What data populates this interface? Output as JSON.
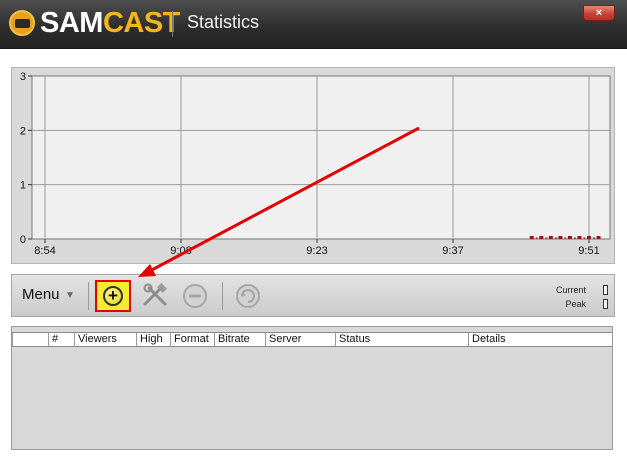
{
  "window": {
    "logo_part1": "SAM",
    "logo_part2": "CAST",
    "title": "Statistics",
    "close_glyph": "×"
  },
  "chart_data": {
    "type": "line",
    "ylim": [
      0,
      3
    ],
    "yticks": [
      "0",
      "1",
      "2",
      "3"
    ],
    "xticks": [
      "8:54",
      "9:08",
      "9:23",
      "9:37",
      "9:51"
    ],
    "grid": true,
    "series": [
      {
        "x": [
          "9:45",
          "9:46",
          "9:47",
          "9:48",
          "9:49",
          "9:50",
          "9:51",
          "9:52"
        ],
        "values": [
          0,
          0,
          0,
          0,
          0,
          0,
          0,
          0
        ],
        "color": "#8b1a1a"
      }
    ]
  },
  "toolbar": {
    "menu_label": "Menu",
    "menu_arrow": "▼",
    "add_glyph": "+",
    "current_label": "Current",
    "peak_label": "Peak"
  },
  "icons": [
    "plus-circle-icon",
    "tools-icon",
    "minus-circle-icon",
    "refresh-icon"
  ],
  "table": {
    "columns": [
      "",
      "#",
      "Viewers",
      "High",
      "Format",
      "Bitrate",
      "Server",
      "Status",
      "Details"
    ],
    "rows": []
  },
  "colors": {
    "annotation": "#e40000",
    "accent": "#f2b51e"
  }
}
